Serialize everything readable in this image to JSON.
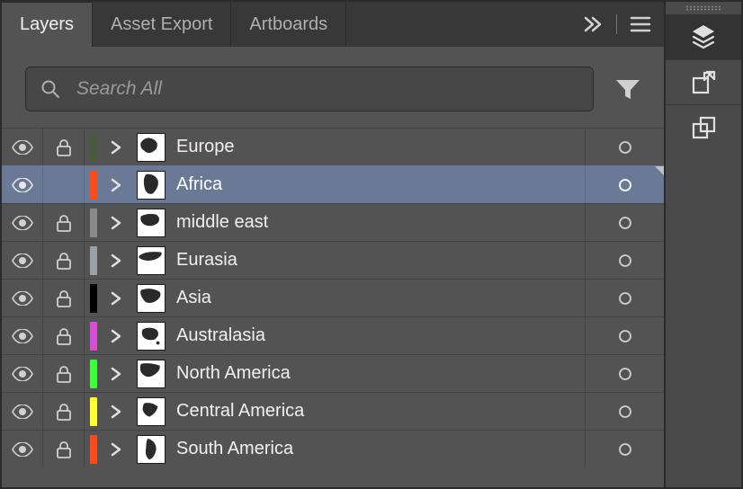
{
  "tabs": [
    {
      "label": "Layers",
      "active": true
    },
    {
      "label": "Asset Export",
      "active": false
    },
    {
      "label": "Artboards",
      "active": false
    }
  ],
  "search": {
    "placeholder": "Search All",
    "value": ""
  },
  "layers": [
    {
      "name": "Europe",
      "color": "#4a5a3c",
      "locked": true,
      "visible": true,
      "selected": false
    },
    {
      "name": "Africa",
      "color": "#ff4a1a",
      "locked": false,
      "visible": true,
      "selected": true
    },
    {
      "name": "middle east",
      "color": "#8a8a8a",
      "locked": true,
      "visible": true,
      "selected": false
    },
    {
      "name": "Eurasia",
      "color": "#9aa3a8",
      "locked": true,
      "visible": true,
      "selected": false
    },
    {
      "name": "Asia",
      "color": "#000000",
      "locked": true,
      "visible": true,
      "selected": false
    },
    {
      "name": "Australasia",
      "color": "#d64ed6",
      "locked": true,
      "visible": true,
      "selected": false
    },
    {
      "name": "North America",
      "color": "#3cff3c",
      "locked": true,
      "visible": true,
      "selected": false
    },
    {
      "name": "Central America",
      "color": "#ffff33",
      "locked": true,
      "visible": true,
      "selected": false
    },
    {
      "name": "South America",
      "color": "#ff4a1a",
      "locked": true,
      "visible": true,
      "selected": false
    }
  ]
}
